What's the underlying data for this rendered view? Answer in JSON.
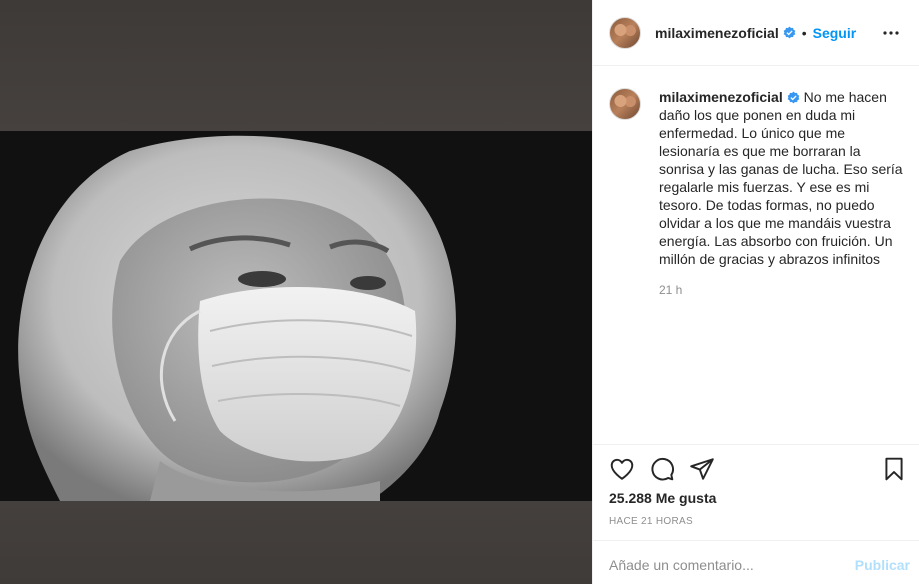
{
  "post": {
    "username": "milaximenezoficial",
    "separator": "•",
    "follow_label": "Seguir",
    "caption_username": "milaximenezoficial",
    "caption_text": "No me hacen daño los que ponen en duda mi enfermedad. Lo único que me lesionaría es que me borraran la sonrisa y las ganas de lucha. Eso sería regalarle mis fuerzas. Y ese es mi tesoro. De todas formas, no puedo olvidar a los que me mandáis vuestra energía. Las absorbo con fruición. Un millón de gracias y abrazos infinitos",
    "caption_time": "21 h",
    "likes": "25.288 Me gusta",
    "posted_ago": "HACE 21 HORAS"
  },
  "comment": {
    "placeholder": "Añade un comentario...",
    "publish_label": "Publicar"
  },
  "colors": {
    "link_blue": "#0095f6",
    "publish_disabled": "#b2dffc",
    "verified_blue": "#3897f0",
    "muted_text": "#8e8e8e"
  },
  "icons": {
    "more": "more-options-icon",
    "like": "heart-icon",
    "comment": "comment-bubble-icon",
    "share": "paper-plane-icon",
    "save": "bookmark-icon",
    "verified": "verified-badge-icon"
  }
}
